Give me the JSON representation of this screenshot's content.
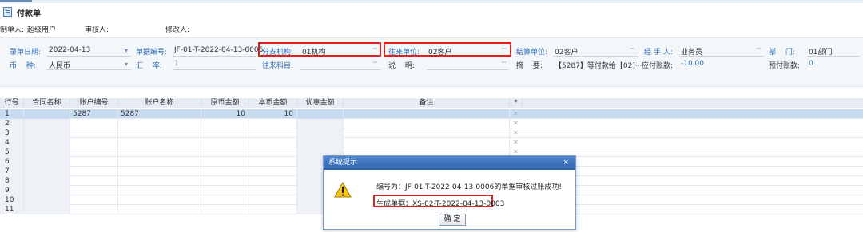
{
  "form": {
    "title": "付款单"
  },
  "meta": {
    "maker_label": "制单人:",
    "maker_value": "超级用户",
    "auditor_label": "审核人:",
    "auditor_value": "",
    "modifier_label": "修改人:",
    "modifier_value": ""
  },
  "fields": {
    "entry_date": {
      "label": "录单日期:",
      "value": "2022-04-13"
    },
    "doc_no": {
      "label": "单据编号:",
      "value": "JF-01-T-2022-04-13-0006"
    },
    "branch": {
      "label": "分支机构:",
      "value": "01机构"
    },
    "partner": {
      "label": "往来单位:",
      "value": "02客户"
    },
    "settle": {
      "label": "结算单位:",
      "value": "02客户"
    },
    "handler": {
      "label": "经 手 人:",
      "value": "业务员"
    },
    "dept": {
      "label": "部　 门:",
      "value": "01部门"
    },
    "currency": {
      "label": "币　 种:",
      "value": "人民币"
    },
    "rate": {
      "label": "汇　 率:",
      "value": "1"
    },
    "account_subject": {
      "label": "往来科目:",
      "value": ""
    },
    "note": {
      "label": "说　 明:",
      "value": ""
    },
    "summary": {
      "label": "摘　 要:",
      "value": "【5287】等付款给【02]···"
    },
    "payable": {
      "label": "应付账款:",
      "value": "-10.00"
    },
    "prepaid": {
      "label": "预付账款:",
      "value": "0"
    }
  },
  "grid": {
    "headers": [
      "行号",
      "合同名称",
      "账户编号",
      "账户名称",
      "原币金额",
      "本币金额",
      "优惠金额",
      "备注",
      "*"
    ],
    "rows": [
      {
        "no": "1",
        "contract": "",
        "acct_no": "5287",
        "acct_name": "5287",
        "orig": "10",
        "local": "10",
        "discount": "",
        "remark": ""
      },
      {
        "no": "2"
      },
      {
        "no": "3"
      },
      {
        "no": "4"
      },
      {
        "no": "5"
      },
      {
        "no": "6"
      },
      {
        "no": "7"
      },
      {
        "no": "8"
      },
      {
        "no": "9"
      },
      {
        "no": "10"
      },
      {
        "no": "11"
      }
    ]
  },
  "dialog": {
    "title": "系统提示",
    "close": "×",
    "message": "编号为：JF-01-T-2022-04-13-0006的单据审核过账成功!",
    "generated": "生成单据：XS-02-T-2022-04-13-0003",
    "ok": "确 定"
  },
  "icons": {
    "dropdown": "▾",
    "ellipsis": "···",
    "row_clear": "✕",
    "warning": "warning-icon"
  },
  "colors": {
    "accent": "#2f6db5",
    "highlight_box": "#e02020",
    "selected_row": "#c8dcf1"
  }
}
